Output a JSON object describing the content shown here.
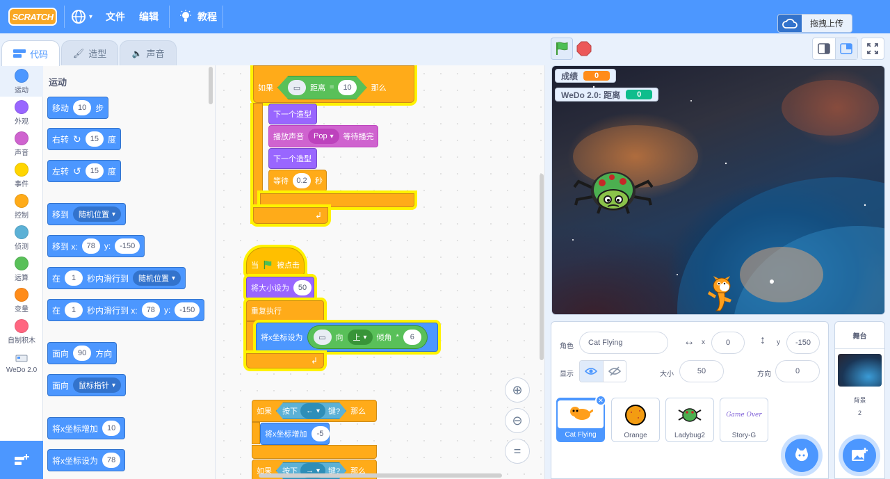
{
  "menubar": {
    "logo": "SCRATCH",
    "file": "文件",
    "edit": "编辑",
    "tutorials": "教程",
    "upload": "拖拽上传"
  },
  "tabs": {
    "code": "代码",
    "costumes": "造型",
    "sounds": "声音"
  },
  "categories": [
    {
      "label": "运动",
      "color": "#4c97ff"
    },
    {
      "label": "外观",
      "color": "#9966ff"
    },
    {
      "label": "声音",
      "color": "#cf63cf"
    },
    {
      "label": "事件",
      "color": "#ffd500"
    },
    {
      "label": "控制",
      "color": "#ffab19"
    },
    {
      "label": "侦测",
      "color": "#5cb1d6"
    },
    {
      "label": "运算",
      "color": "#59c059"
    },
    {
      "label": "变量",
      "color": "#ff8c1a"
    },
    {
      "label": "自制积木",
      "color": "#ff6680"
    },
    {
      "label": "WeDo 2.0",
      "color": "#e8edf4"
    }
  ],
  "flyout": {
    "section": "运动",
    "move": {
      "pre": "移动",
      "val": "10",
      "post": "步"
    },
    "turn_right": {
      "pre": "右转",
      "val": "15",
      "post": "度"
    },
    "turn_left": {
      "pre": "左转",
      "val": "15",
      "post": "度"
    },
    "goto": {
      "pre": "移到",
      "dd": "随机位置"
    },
    "goto_xy": {
      "pre": "移到 x:",
      "x": "78",
      "mid": "y:",
      "y": "-150"
    },
    "glide_random": {
      "pre": "在",
      "val": "1",
      "mid": "秒内滑行到",
      "dd": "随机位置"
    },
    "glide_xy": {
      "pre": "在",
      "val": "1",
      "mid": "秒内滑行到 x:",
      "x": "78",
      "mid2": "y:",
      "y": "-150"
    },
    "point_dir": {
      "pre": "面向",
      "val": "90",
      "post": "方向"
    },
    "point_towards": {
      "pre": "面向",
      "dd": "鼠标指针"
    },
    "change_x": {
      "pre": "将x坐标增加",
      "val": "10"
    },
    "set_x": {
      "pre": "将x坐标设为",
      "val": "78"
    }
  },
  "workspace": {
    "if1": {
      "kw": "如果",
      "sensor": "距离",
      "eq": "=",
      "val": "10",
      "then": "那么"
    },
    "next_costume": "下一个造型",
    "play_sound": {
      "pre": "播放声音",
      "dd": "Pop",
      "post": "等待播完"
    },
    "next_costume2": "下一个造型",
    "wait": {
      "pre": "等待",
      "val": "0.2",
      "post": "秒"
    },
    "hat": {
      "pre": "当",
      "post": "被点击"
    },
    "set_size": {
      "pre": "将大小设为",
      "val": "50"
    },
    "forever": "重复执行",
    "set_x_tilt": {
      "pre": "将x坐标设为",
      "dir": "向",
      "dd": "上",
      "tilt": "倾角",
      "mul": "*",
      "val": "6"
    },
    "if_left": {
      "kw": "如果",
      "key": "按下",
      "dd": "←",
      "q": "键?",
      "then": "那么"
    },
    "change_x": {
      "pre": "将x坐标增加",
      "val": "-5"
    },
    "if_right": {
      "kw": "如果",
      "key": "按下",
      "dd": "→",
      "q": "键?",
      "then": "那么"
    }
  },
  "stage": {
    "score_label": "成绩",
    "score_value": "0",
    "wedo_label": "WeDo 2.0: 距离",
    "wedo_value": "0"
  },
  "sprite_info": {
    "sprite_label": "角色",
    "sprite_name": "Cat Flying",
    "x_label": "x",
    "x": "0",
    "y_label": "y",
    "y": "-150",
    "show_label": "显示",
    "size_label": "大小",
    "size": "50",
    "direction_label": "方向",
    "direction": "0"
  },
  "sprites": [
    {
      "name": "Cat Flying"
    },
    {
      "name": "Orange"
    },
    {
      "name": "Ladybug2"
    },
    {
      "name": "Story-G",
      "art_text": "Game Over"
    }
  ],
  "stage_pane": {
    "title": "舞台",
    "backdrops_label": "背景",
    "backdrops_count": "2"
  }
}
